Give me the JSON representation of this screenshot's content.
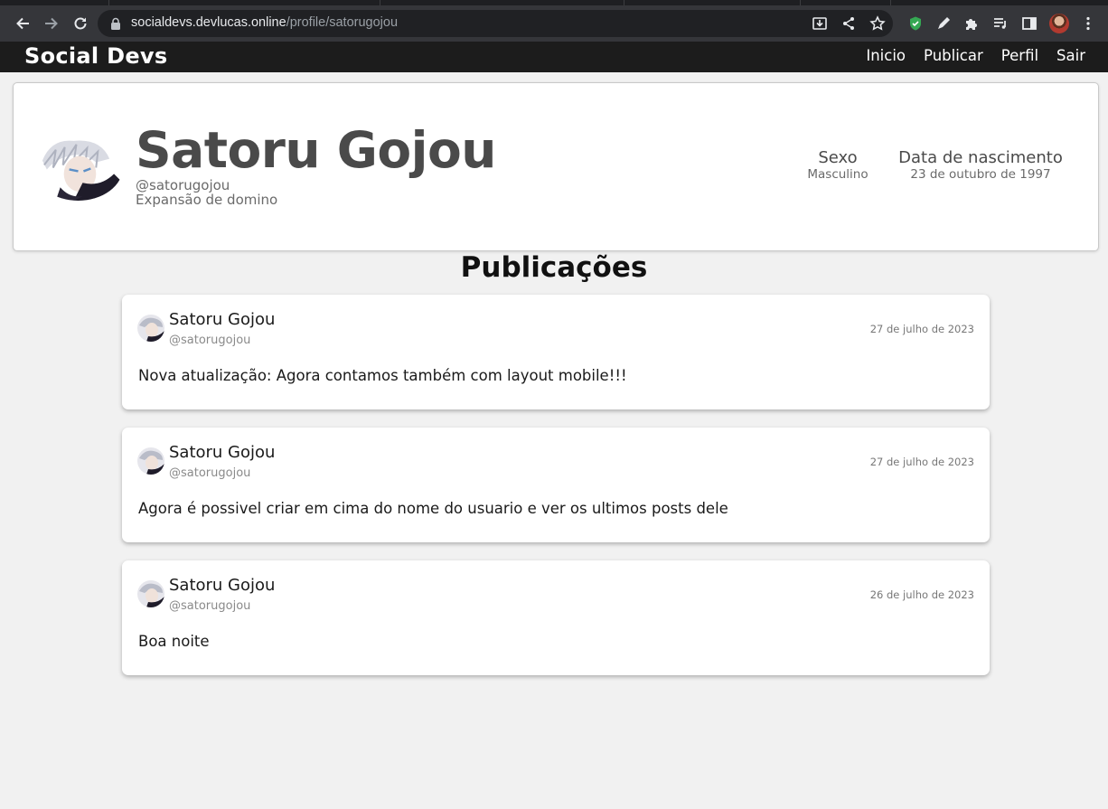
{
  "browser": {
    "url_host": "socialdevs.devlucas.online",
    "url_path": "/profile/satorugojou"
  },
  "site": {
    "brand": "Social Devs",
    "nav": [
      "Inicio",
      "Publicar",
      "Perfil",
      "Sair"
    ]
  },
  "profile": {
    "name": "Satoru Gojou",
    "handle": "@satorugojou",
    "bio": "Expansão de domino",
    "gender_label": "Sexo",
    "gender_value": "Masculino",
    "birth_label": "Data de nascimento",
    "birth_value": "23 de outubro de 1997"
  },
  "posts_title": "Publicações",
  "posts": [
    {
      "author": "Satoru Gojou",
      "handle": "@satorugojou",
      "date": "27 de julho de 2023",
      "text": "Nova atualização: Agora contamos também com layout mobile!!!"
    },
    {
      "author": "Satoru Gojou",
      "handle": "@satorugojou",
      "date": "27 de julho de 2023",
      "text": "Agora é possivel criar em cima do nome do usuario e ver os ultimos posts dele"
    },
    {
      "author": "Satoru Gojou",
      "handle": "@satorugojou",
      "date": "26 de julho de 2023",
      "text": "Boa noite"
    }
  ]
}
